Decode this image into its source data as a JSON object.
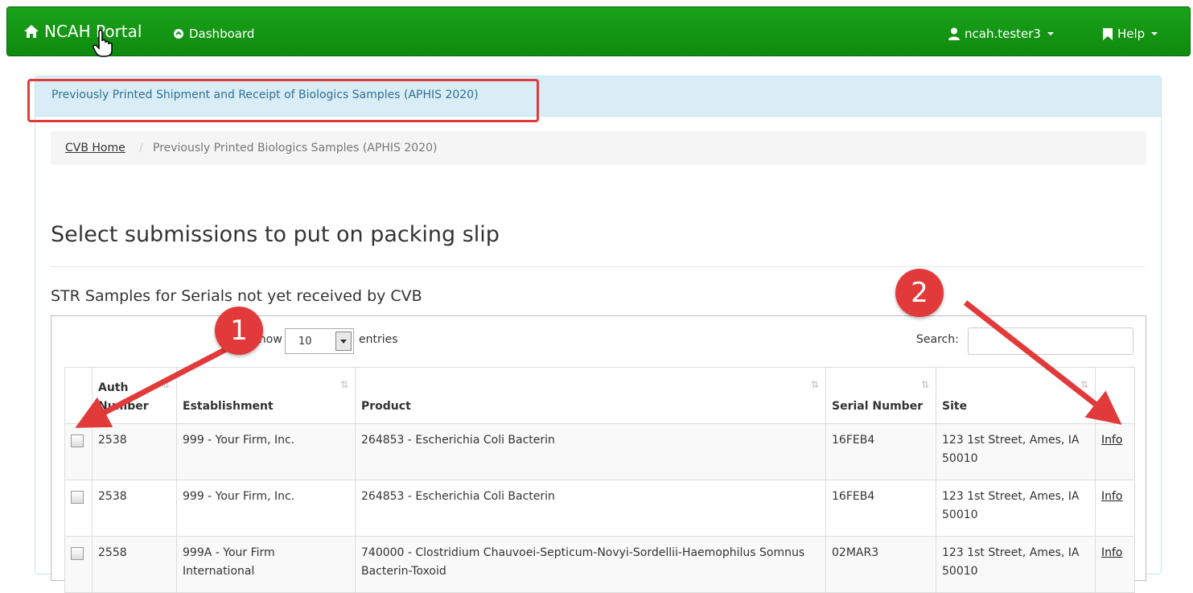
{
  "navbar": {
    "brand": "NCAH Portal",
    "dashboard": "Dashboard",
    "user": "ncah.tester3",
    "help": "Help"
  },
  "panel": {
    "title": "Previously Printed Shipment and Receipt of Biologics Samples (APHIS 2020)"
  },
  "breadcrumb": {
    "home": "CVB Home",
    "separator": "/",
    "current": "Previously Printed Biologics Samples (APHIS 2020)"
  },
  "page_header": "Select submissions to put on packing slip",
  "section_title": "STR Samples for Serials not yet received by CVB",
  "table_controls": {
    "show_label": "Show",
    "entries_value": "10",
    "entries_label": "entries",
    "search_label": "Search:",
    "search_value": ""
  },
  "table": {
    "headers": [
      "Auth Number",
      "Establishment",
      "Product",
      "Serial Number",
      "Site"
    ],
    "rows": [
      {
        "auth": "2538",
        "establishment": "999 - Your Firm, Inc.",
        "product": "264853 - Escherichia Coli Bacterin",
        "serial": "16FEB4",
        "site": "123 1st Street, Ames, IA 50010",
        "action": "Info"
      },
      {
        "auth": "2538",
        "establishment": "999 - Your Firm, Inc.",
        "product": "264853 - Escherichia Coli Bacterin",
        "serial": "16FEB4",
        "site": "123 1st Street, Ames, IA 50010",
        "action": "Info"
      },
      {
        "auth": "2558",
        "establishment": "999A - Your Firm International",
        "product": "740000 - Clostridium Chauvoei-Septicum-Novyi-Sordellii-Haemophilus Somnus Bacterin-Toxoid",
        "serial": "02MAR3",
        "site": "123 1st Street, Ames, IA 50010",
        "action": "Info"
      }
    ]
  },
  "annotations": {
    "marker_1": "1",
    "marker_2": "2",
    "color": "#e23a3a"
  },
  "colors": {
    "navbar": "#139613",
    "panel_heading": "#d9edf7",
    "highlight": "#e03c3c"
  }
}
